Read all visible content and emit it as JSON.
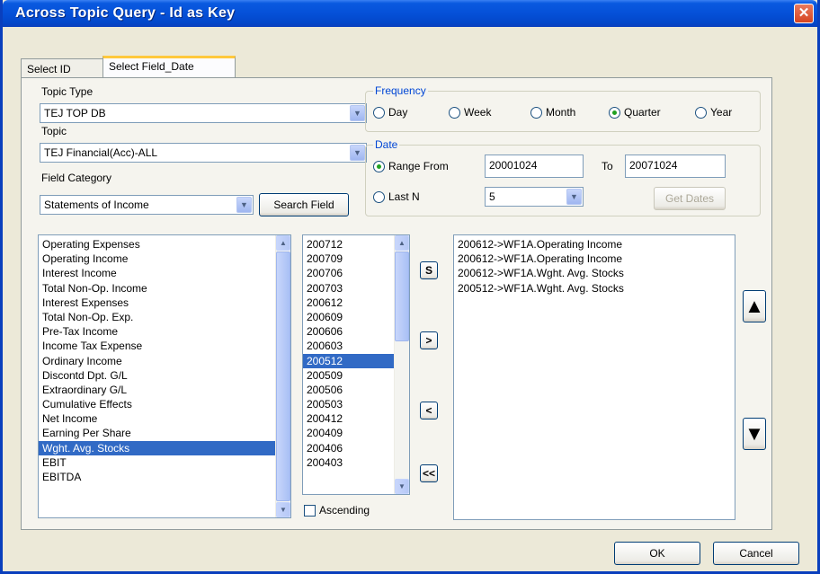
{
  "window": {
    "title": "Across Topic Query - Id as Key",
    "close_glyph": "✕"
  },
  "tabs": [
    {
      "label": "Select ID",
      "active": false
    },
    {
      "label": "Select Field_Date",
      "active": true
    }
  ],
  "topic_type": {
    "label": "Topic Type",
    "value": "TEJ TOP DB"
  },
  "topic": {
    "label": "Topic",
    "value": "TEJ Financial(Acc)-ALL"
  },
  "field_category": {
    "label": "Field Category",
    "value": "Statements of Income",
    "search_button": "Search Field"
  },
  "frequency": {
    "title": "Frequency",
    "options": [
      {
        "label": "Day",
        "checked": false
      },
      {
        "label": "Week",
        "checked": false
      },
      {
        "label": "Month",
        "checked": false
      },
      {
        "label": "Quarter",
        "checked": true
      },
      {
        "label": "Year",
        "checked": false
      }
    ]
  },
  "date": {
    "title": "Date",
    "range_from_label": "Range From",
    "range_from_value": "20001024",
    "to_label": "To",
    "to_value": "20071024",
    "last_n_label": "Last N",
    "last_n_value": "5",
    "range_selected": true,
    "get_dates_button": "Get Dates"
  },
  "fields_list": {
    "items": [
      "Operating Expenses",
      "Operating Income",
      "Interest Income",
      "Total Non-Op. Income",
      "Interest Expenses",
      "Total Non-Op. Exp.",
      "Pre-Tax Income",
      "Income Tax Expense",
      "Ordinary Income",
      "Discontd Dpt. G/L",
      "Extraordinary G/L",
      "Cumulative Effects",
      "Net Income",
      "Earning Per Share",
      "Wght. Avg. Stocks",
      "EBIT",
      "EBITDA"
    ],
    "selected_index": 14
  },
  "dates_list": {
    "items": [
      "200712",
      "200709",
      "200706",
      "200703",
      "200612",
      "200609",
      "200606",
      "200603",
      "200512",
      "200509",
      "200506",
      "200503",
      "200412",
      "200409",
      "200406",
      "200403"
    ],
    "selected_index": 8,
    "ascending_label": "Ascending"
  },
  "transfer_buttons": {
    "select": "S",
    "add": ">",
    "remove": "<",
    "remove_all": "<<"
  },
  "selected_list": {
    "items": [
      "200612->WF1A.Operating Income",
      "200612->WF1A.Operating Income",
      "200612->WF1A.Wght. Avg. Stocks",
      "200512->WF1A.Wght. Avg. Stocks"
    ]
  },
  "move_buttons": {
    "up": "▲",
    "down": "▼"
  },
  "footer": {
    "ok": "OK",
    "cancel": "Cancel"
  }
}
